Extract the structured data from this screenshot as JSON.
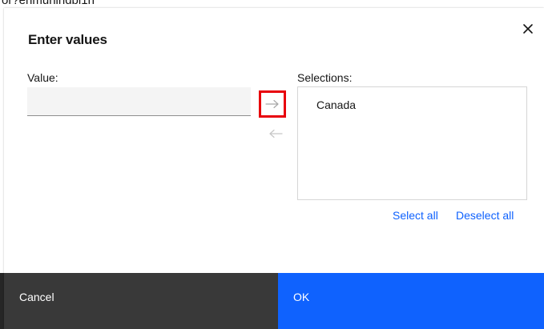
{
  "background": {
    "partial_text": "or?ehmuhlndbi1h"
  },
  "dialog": {
    "title": "Enter values",
    "close_icon": "close-icon",
    "value_label": "Value:",
    "value_input": "",
    "add_icon": "arrow-right-icon",
    "remove_icon": "arrow-left-icon",
    "selections_label": "Selections:",
    "selections": [
      "Canada"
    ],
    "select_all_label": "Select all",
    "deselect_all_label": "Deselect all",
    "cancel_label": "Cancel",
    "ok_label": "OK"
  },
  "colors": {
    "primary": "#0f62fe",
    "secondary_button": "#393939",
    "highlight_box": "#e8000b",
    "text": "#161616",
    "input_bg": "#f4f4f4"
  }
}
